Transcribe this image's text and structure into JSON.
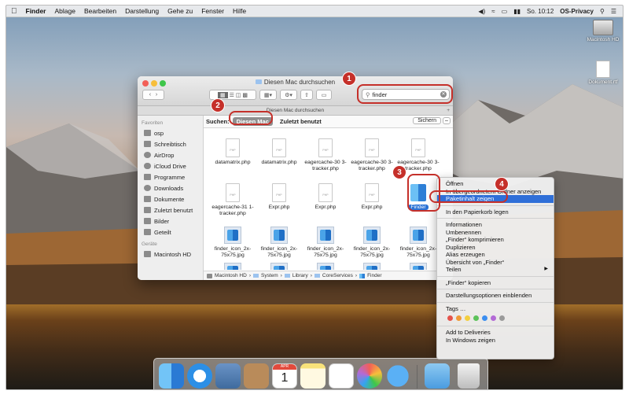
{
  "menubar": {
    "apple": "",
    "items": [
      "Finder",
      "Ablage",
      "Bearbeiten",
      "Darstellung",
      "Gehe zu",
      "Fenster",
      "Hilfe"
    ],
    "clock": "So. 10:12",
    "user": "OS-Privacy"
  },
  "desktop": {
    "icons": [
      {
        "label": "Macintosh HD"
      },
      {
        "label": "Dokument.rtf"
      }
    ]
  },
  "finder": {
    "title": "Diesen Mac durchsuchen",
    "tab_title": "Diesen Mac durchsuchen",
    "search_value": "finder",
    "scope": {
      "label": "Suchen:",
      "active": "Diesen Mac",
      "other": "Zuletzt benutzt",
      "save": "Sichern"
    },
    "sidebar": {
      "favorites_heading": "Favoriten",
      "favorites": [
        "osp",
        "Schreibtisch",
        "AirDrop",
        "iCloud Drive",
        "Programme",
        "Downloads",
        "Dokumente",
        "Zuletzt benutzt",
        "Bilder",
        "Geteilt"
      ],
      "devices_heading": "Geräte",
      "devices": [
        "Macintosh HD"
      ]
    },
    "files": [
      {
        "name": "datamatrix.php",
        "kind": "php"
      },
      {
        "name": "datamatrix.php",
        "kind": "php"
      },
      {
        "name": "eagercache-30 3-tracker.php",
        "kind": "php"
      },
      {
        "name": "eagercache-30 3-tracker.php",
        "kind": "php"
      },
      {
        "name": "eagercache-30 3-tracker.php",
        "kind": "php"
      },
      {
        "name": "eagercache-31 1-tracker.php",
        "kind": "php"
      },
      {
        "name": "Expr.php",
        "kind": "php"
      },
      {
        "name": "Expr.php",
        "kind": "php"
      },
      {
        "name": "Expr.php",
        "kind": "php"
      },
      {
        "name": "Finder",
        "kind": "app"
      },
      {
        "name": "finder_icon_2x-75x75.jpg",
        "kind": "jpg"
      },
      {
        "name": "finder_icon_2x-75x75.jpg",
        "kind": "jpg"
      },
      {
        "name": "finder_icon_2x-75x75.jpg",
        "kind": "jpg"
      },
      {
        "name": "finder_icon_2x-75x75.jpg",
        "kind": "jpg"
      },
      {
        "name": "finder_icon_2x-75x75.jpg",
        "kind": "jpg"
      }
    ],
    "path": [
      "Macintosh HD",
      "System",
      "Library",
      "CoreServices",
      "Finder"
    ]
  },
  "context_menu": {
    "items": [
      {
        "label": "Öffnen"
      },
      {
        "label": "In übergeordnetem Ordner anzeigen"
      },
      {
        "label": "Paketinhalt zeigen",
        "highlight": true
      },
      {
        "sep": true
      },
      {
        "label": "In den Papierkorb legen"
      },
      {
        "sep": true
      },
      {
        "label": "Informationen"
      },
      {
        "label": "Umbenennen"
      },
      {
        "label": "„Finder“ komprimieren"
      },
      {
        "label": "Duplizieren"
      },
      {
        "label": "Alias erzeugen"
      },
      {
        "label": "Übersicht von „Finder“"
      },
      {
        "label": "Teilen",
        "submenu": true
      },
      {
        "sep": true
      },
      {
        "label": "„Finder“ kopieren"
      },
      {
        "sep": true
      },
      {
        "label": "Darstellungsoptionen einblenden"
      },
      {
        "sep": true
      },
      {
        "label": "Tags …"
      },
      {
        "tags": true
      },
      {
        "sep": true
      },
      {
        "label": "Add to Deliveries"
      },
      {
        "label": "In Windows zeigen"
      }
    ],
    "tag_colors": [
      "#e5534b",
      "#f09a37",
      "#f3cf3f",
      "#5cc25a",
      "#3b8ef0",
      "#b36ad6",
      "#9a9a9a"
    ]
  },
  "annotations": [
    "1",
    "2",
    "3",
    "4"
  ],
  "dock": {
    "apps": [
      "finder",
      "safari",
      "preview",
      "contacts",
      "calendar",
      "notes",
      "reminders",
      "photos",
      "messages",
      "downloads",
      "trash"
    ],
    "calendar_day": "1",
    "calendar_month": "APR"
  },
  "colors": {
    "annotation_red": "#c5302a",
    "selection_blue": "#2f6fd8"
  }
}
